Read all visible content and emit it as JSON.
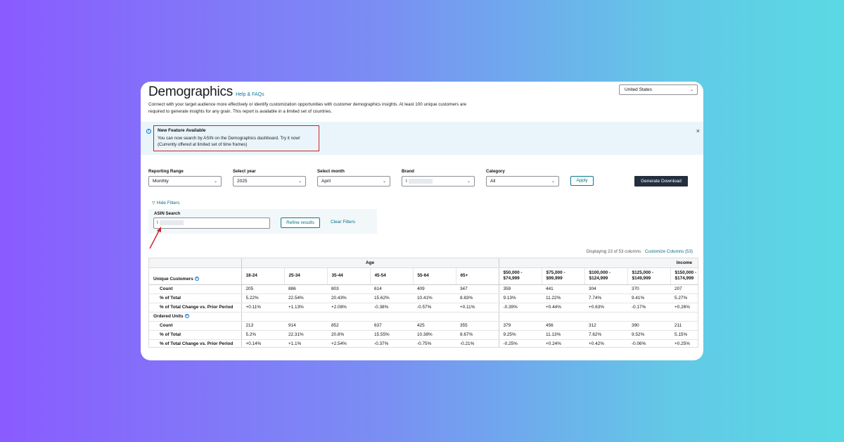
{
  "header": {
    "title": "Demographics",
    "help_link": "Help & FAQs",
    "description": "Connect with your target audience more effectively or identify customization opportunities with customer demographics insights. At least 100 unique customers are required to generate insights for any grain. This report is available in a limited set of countries.",
    "country": "United States"
  },
  "banner": {
    "title": "New Feature Available",
    "line1": "You can now search by ASIN on the Demographics dashboard. Try it now!",
    "line2": "(Currently offered at limited set of time frames)",
    "close": "×"
  },
  "filters": {
    "reporting_range": {
      "label": "Reporting Range",
      "value": "Monthly"
    },
    "year": {
      "label": "Select year",
      "value": "2025"
    },
    "month": {
      "label": "Select month",
      "value": "April"
    },
    "brand": {
      "label": "Brand",
      "value": "I"
    },
    "category": {
      "label": "Category",
      "value": "All"
    },
    "apply": "Apply",
    "generate": "Generate Download",
    "hide_filters": "Hide Filters",
    "asin_label": "ASIN Search",
    "asin_value": "I",
    "refine": "Refine results",
    "clear": "Clear Filters"
  },
  "table_meta": {
    "displaying": "Displaying 23 of 53 columns",
    "customize": "Customize Columns (53)"
  },
  "table": {
    "group_age": "Age",
    "group_income": "Income",
    "first_header": "Unique Customers",
    "columns": [
      "18-24",
      "25-34",
      "35-44",
      "45-54",
      "55-64",
      "65+",
      "$50,000 -",
      "$75,000 -",
      "$100,000 -",
      "$125,000 -",
      "$150,000 -"
    ],
    "columns_line2": [
      "",
      "",
      "",
      "",
      "",
      "",
      "$74,999",
      "$99,999",
      "$124,999",
      "$149,999",
      "$174,999"
    ],
    "uc_rows": [
      {
        "label": "Count",
        "values": [
          "205",
          "886",
          "803",
          "614",
          "409",
          "347",
          "359",
          "441",
          "304",
          "370",
          "207"
        ]
      },
      {
        "label": "% of Total",
        "values": [
          "5.22%",
          "22.54%",
          "20.43%",
          "15.62%",
          "10.41%",
          "8.83%",
          "9.13%",
          "11.22%",
          "7.74%",
          "9.41%",
          "5.27%"
        ]
      },
      {
        "label": "% of Total Change vs. Prior Period",
        "values": [
          "+0.11%",
          "+1.13%",
          "+2.08%",
          "-0.38%",
          "-0.57%",
          "+0.11%",
          "-0.39%",
          "+0.44%",
          "+0.63%",
          "-0.17%",
          "+0.26%"
        ]
      }
    ],
    "ou_section": "Ordered Units",
    "ou_rows": [
      {
        "label": "Count",
        "values": [
          "213",
          "914",
          "852",
          "637",
          "425",
          "355",
          "379",
          "456",
          "312",
          "390",
          "211"
        ]
      },
      {
        "label": "% of Total",
        "values": [
          "5.2%",
          "22.31%",
          "20.8%",
          "15.55%",
          "10.38%",
          "8.67%",
          "9.25%",
          "11.13%",
          "7.62%",
          "9.52%",
          "5.15%"
        ]
      },
      {
        "label": "% of Total Change vs. Prior Period",
        "values": [
          "+0.14%",
          "+1.1%",
          "+2.54%",
          "-0.37%",
          "-0.75%",
          "-0.21%",
          "-0.25%",
          "+0.24%",
          "+0.42%",
          "-0.06%",
          "+0.25%"
        ]
      }
    ]
  },
  "colors": {
    "accent": "#0a6e7e",
    "alert_border": "#d0202c",
    "banner_bg": "#e9f5fb",
    "primary_button": "#232f3e"
  }
}
